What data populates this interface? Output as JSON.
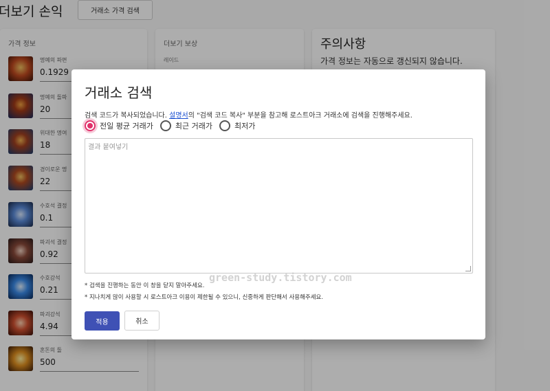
{
  "page": {
    "title": "더보기 손익",
    "search_button": "거래소 가격 검색"
  },
  "price_card": {
    "title": "가격 정보",
    "items": [
      {
        "label": "명예의 파편",
        "value": "0.1929",
        "icon": "honor-shard-icon",
        "color": "#a03a1a"
      },
      {
        "label": "명예의 돌파",
        "value": "20",
        "icon": "honor-leapstone-icon",
        "color": "#2b3d8a"
      },
      {
        "label": "위대한 명여",
        "value": "18",
        "icon": "great-honor-leapstone-icon",
        "color": "#2a4a7c"
      },
      {
        "label": "경이로운 명",
        "value": "22",
        "icon": "marvelous-honor-leapstone-icon",
        "color": "#2a4a7c"
      },
      {
        "label": "수호석 결정",
        "value": "0.1",
        "icon": "guardian-stone-crystal-icon",
        "color": "#4a6ea8"
      },
      {
        "label": "파괴석 결정",
        "value": "0.92",
        "icon": "destruction-stone-crystal-icon",
        "color": "#7a3a2a"
      },
      {
        "label": "수호강석",
        "value": "0.21",
        "icon": "guardian-stone-icon",
        "color": "#3a7ad8"
      },
      {
        "label": "파괴강석",
        "value": "4.94",
        "icon": "destruction-stone-icon",
        "color": "#b04a2a"
      },
      {
        "label": "혼돈의 돌",
        "value": "500",
        "icon": "chaos-stone-icon",
        "color": "#c07a1a"
      }
    ]
  },
  "reward_card": {
    "title": "더보기 보상",
    "subtitle": "레이드"
  },
  "notice_card": {
    "title": "주의사항",
    "text": "가격 정보는 자동으로 갱신되지 않습니다."
  },
  "dialog": {
    "title": "거래소 검색",
    "desc_before": "검색 코드가 복사되었습니다. ",
    "desc_link": "설명서",
    "desc_after": "의 \"검색 코드 복사\" 부분을 참고해 로스트아크 거래소에 검색을 진행해주세요.",
    "radios": [
      {
        "label": "전일 평균 거래가",
        "checked": true
      },
      {
        "label": "최근 거래가",
        "checked": false
      },
      {
        "label": "최저가",
        "checked": false
      }
    ],
    "textarea_placeholder": "결과 붙여넣기",
    "watermark": "green-study.tistory.com",
    "notes": [
      "* 검색을 진행하는 동안 이 창을 닫지 말아주세요.",
      "* 지나치게 많이 사용할 시 로스트아크 이용이 제한될 수 있으니, 신중하게 판단해서 사용해주세요."
    ],
    "apply_label": "적용",
    "cancel_label": "취소",
    "accent_color": "#e0306a",
    "primary_color": "#3f51b5"
  }
}
